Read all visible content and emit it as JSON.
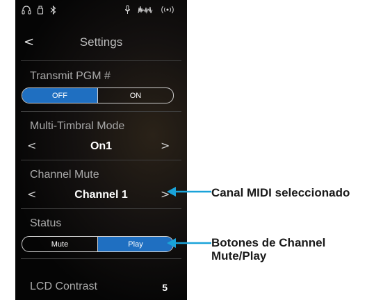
{
  "status_bar": {
    "icons": [
      "headphones-icon",
      "usb-icon",
      "bluetooth-icon",
      "microphone-icon",
      "audio-meter-icon",
      "wireless-icon"
    ]
  },
  "header": {
    "title": "Settings",
    "back_glyph": "<"
  },
  "settings": {
    "transmit_pgm": {
      "label": "Transmit PGM #",
      "options": [
        "OFF",
        "ON"
      ],
      "selected": "OFF"
    },
    "multi_timbral_mode": {
      "label": "Multi-Timbral Mode",
      "value": "On1"
    },
    "channel_mute": {
      "label": "Channel Mute",
      "value": "Channel 1"
    },
    "status": {
      "label": "Status",
      "options": [
        "Mute",
        "Play"
      ],
      "selected": "Play"
    },
    "lcd_contrast": {
      "label": "LCD Contrast",
      "value": "5"
    }
  },
  "annotations": {
    "midi_channel": "Canal MIDI seleccionado",
    "mute_play": [
      "Botones de Channel",
      "Mute/Play"
    ]
  },
  "colors": {
    "accent": "#1f6fc1",
    "pointer": "#1aa3d9",
    "background": "#0a0908"
  }
}
